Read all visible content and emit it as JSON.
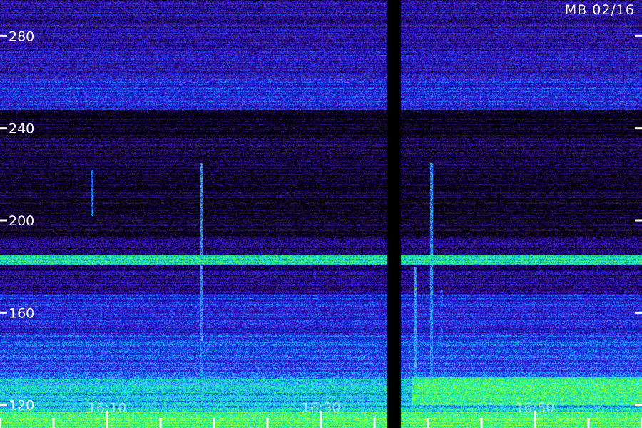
{
  "header": {
    "station_label": "MB 02/16"
  },
  "colors": {
    "background": "#000000",
    "tick": "#ffffff",
    "gap": "#000000"
  },
  "colormap": [
    "#000000",
    "#2a0a6e",
    "#3a10c8",
    "#1e3cff",
    "#1aa0ff",
    "#1fe8d0",
    "#2aff60",
    "#b8ff1a"
  ],
  "chart_data": {
    "type": "heatmap",
    "title": "",
    "xlabel": "",
    "ylabel": "",
    "y_range": [
      110,
      290
    ],
    "x_range_minutes": [
      0,
      60
    ],
    "y_ticks": [
      120,
      160,
      200,
      240,
      280
    ],
    "y_tick_labels": [
      "120",
      "160",
      "200",
      "240",
      "280"
    ],
    "x_ticks_minutes": [
      10,
      30,
      50
    ],
    "x_tick_labels": [
      "16:10",
      "16:30",
      "16:50"
    ],
    "data_gap_minutes": [
      36.2,
      37.4
    ],
    "bands": [
      {
        "y_from": 110,
        "y_to": 117,
        "level": 0.85
      },
      {
        "y_from": 117,
        "y_to": 132,
        "level": 0.62
      },
      {
        "y_from": 132,
        "y_to": 150,
        "level": 0.42
      },
      {
        "y_from": 150,
        "y_to": 168,
        "level": 0.34
      },
      {
        "y_from": 168,
        "y_to": 178,
        "level": 0.18
      },
      {
        "y_from": 178,
        "y_to": 181,
        "level": 0.14
      },
      {
        "y_from": 181,
        "y_to": 185,
        "level": 0.72
      },
      {
        "y_from": 185,
        "y_to": 192,
        "level": 0.16
      },
      {
        "y_from": 192,
        "y_to": 228,
        "level": 0.02
      },
      {
        "y_from": 228,
        "y_to": 236,
        "level": 0.08
      },
      {
        "y_from": 236,
        "y_to": 248,
        "level": 0.02
      },
      {
        "y_from": 248,
        "y_to": 262,
        "level": 0.34
      },
      {
        "y_from": 262,
        "y_to": 275,
        "level": 0.26
      },
      {
        "y_from": 275,
        "y_to": 290,
        "level": 0.22
      }
    ],
    "events": [
      {
        "x_minutes": 8.6,
        "y_from": 202,
        "y_to": 222,
        "level": 0.5
      },
      {
        "x_minutes": 18.8,
        "y_from": 110,
        "y_to": 225,
        "level": 0.55
      },
      {
        "x_minutes": 32.8,
        "y_from": 110,
        "y_to": 135,
        "level": 0.45
      },
      {
        "x_minutes": 38.8,
        "y_from": 110,
        "y_to": 180,
        "level": 0.6
      },
      {
        "x_minutes": 40.3,
        "y_from": 110,
        "y_to": 225,
        "level": 0.55
      },
      {
        "x_minutes": 41.2,
        "y_from": 130,
        "y_to": 170,
        "level": 0.4
      }
    ],
    "enhanced_regions": [
      {
        "x_from_minutes": 38.5,
        "x_to_minutes": 60,
        "y_from": 120,
        "y_to": 132,
        "level": 0.8
      }
    ]
  }
}
